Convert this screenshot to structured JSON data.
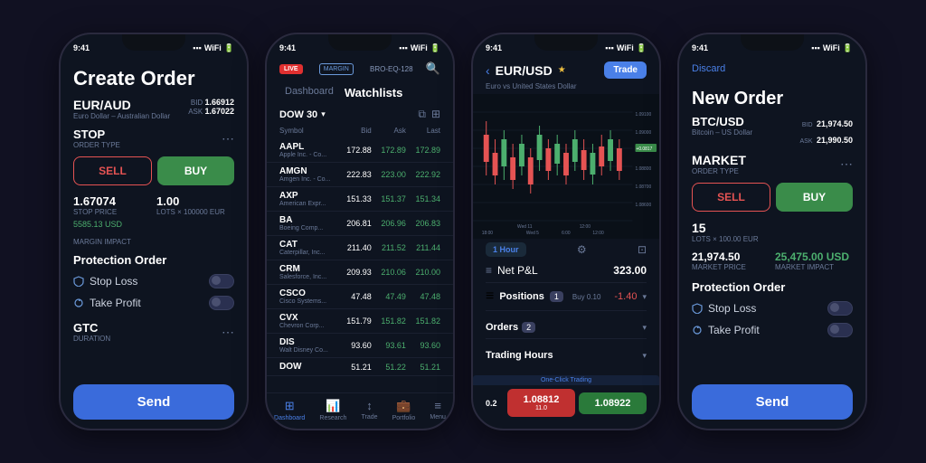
{
  "scene": {
    "background": "#111122"
  },
  "phone1": {
    "status_time": "9:41",
    "title": "Create Order",
    "pair": "EUR/AUD",
    "pair_full": "Euro Dollar – Australian Dollar",
    "bid_label": "BID",
    "bid_val": "1.66912",
    "ask_label": "ASK",
    "ask_val": "1.67022",
    "order_type": "STOP",
    "order_type_sub": "ORDER TYPE",
    "sell_label": "SELL",
    "buy_label": "BUY",
    "stop_price": "1.67074",
    "stop_price_sub": "STOP PRICE",
    "lots": "1.00",
    "lots_sub": "LOTS × 100000 EUR",
    "margin": "5585.13 USD",
    "margin_sub": "MARGIN IMPACT",
    "protection_title": "Protection Order",
    "stop_loss": "Stop Loss",
    "take_profit": "Take Profit",
    "duration_val": "GTC",
    "duration_sub": "DURATION",
    "send_label": "Send"
  },
  "phone2": {
    "status_time": "9:41",
    "live_badge": "LIVE",
    "margin_badge": "MARGIN",
    "broker": "BRO-EQ-128",
    "tab_dashboard": "Dashboard",
    "tab_watchlists": "Watchlists",
    "dow_label": "DOW 30",
    "col_symbol": "Symbol",
    "col_bid": "Bid",
    "col_ask": "Ask",
    "col_last": "Last",
    "rows": [
      {
        "symbol": "AAPL",
        "company": "Apple Inc. - Co...",
        "bid": "172.88",
        "ask": "172.89",
        "last": "172.89"
      },
      {
        "symbol": "AMGN",
        "company": "Amgen Inc. - Co...",
        "bid": "222.83",
        "ask": "223.00",
        "last": "222.92"
      },
      {
        "symbol": "AXP",
        "company": "American Expr...",
        "bid": "151.33",
        "ask": "151.37",
        "last": "151.34"
      },
      {
        "symbol": "BA",
        "company": "Boeing Comp...",
        "bid": "206.81",
        "ask": "206.96",
        "last": "206.83"
      },
      {
        "symbol": "CAT",
        "company": "Caterpillar, Inc...",
        "bid": "211.40",
        "ask": "211.52",
        "last": "211.44"
      },
      {
        "symbol": "CRM",
        "company": "Salesforce, Inc...",
        "bid": "209.93",
        "ask": "210.06",
        "last": "210.00"
      },
      {
        "symbol": "CSCO",
        "company": "Cisco Systems...",
        "bid": "47.48",
        "ask": "47.49",
        "last": "47.48"
      },
      {
        "symbol": "CVX",
        "company": "Chevron Corp...",
        "bid": "151.79",
        "ask": "151.82",
        "last": "151.82"
      },
      {
        "symbol": "DIS",
        "company": "Walt Disney Co...",
        "bid": "93.60",
        "ask": "93.61",
        "last": "93.60"
      },
      {
        "symbol": "DOW",
        "company": "",
        "bid": "51.21",
        "ask": "51.22",
        "last": "51.21"
      }
    ],
    "nav": [
      "Dashboard",
      "Research",
      "Trade",
      "Portfolio",
      "Menu"
    ]
  },
  "phone3": {
    "status_time": "9:41",
    "pair": "EUR/USD",
    "pair_full": "Euro vs United States Dollar",
    "trade_btn": "Trade",
    "chart_prices": [
      "1.09100",
      "1.09000",
      "1.08900",
      "1.08800",
      "1.08700",
      "1.08600"
    ],
    "price_badge": "+0.0817",
    "timeframe": "1 Hour",
    "pnl_label": "Net P&L",
    "pnl_val": "323.00",
    "positions_label": "Positions",
    "positions_count": "1",
    "positions_sub": "Buy 0.10",
    "positions_val": "-1.40",
    "orders_label": "Orders",
    "orders_count": "2",
    "trading_hours": "Trading Hours",
    "one_click": "One-Click Trading",
    "spread": "0.2",
    "sell_price": "1.08812",
    "sell_sub": "11.0",
    "buy_price": "1.08922",
    "buy_sub": ""
  },
  "phone4": {
    "status_time": "9:41",
    "discard": "Discard",
    "title": "New Order",
    "pair": "BTC/USD",
    "pair_full": "Bitcoin – US Dollar",
    "bid_label": "BID",
    "bid_val": "21,974.50",
    "ask_label": "ASK",
    "ask_val": "21,990.50",
    "order_type": "MARKET",
    "order_type_sub": "ORDER TYPE",
    "sell_label": "SELL",
    "buy_label": "BUY",
    "lots": "15",
    "lots_sub": "LOTS × 100.00 EUR",
    "market_price": "21,974.50",
    "market_price_sub": "MARKET PRICE",
    "market_impact": "25,475.00 USD",
    "market_impact_sub": "MARKET IMPACT",
    "protection_title": "Protection Order",
    "stop_loss": "Stop Loss",
    "take_profit": "Take Profit",
    "send_label": "Send"
  }
}
